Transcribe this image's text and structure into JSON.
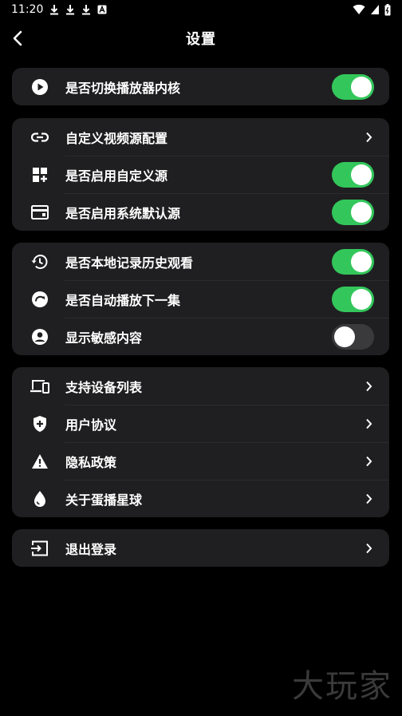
{
  "status": {
    "time": "11:20"
  },
  "header": {
    "title": "设置"
  },
  "groups": [
    {
      "items": [
        {
          "label": "是否切换播放器内核",
          "icon": "play-circle-icon",
          "control": "toggle",
          "on": true
        }
      ]
    },
    {
      "items": [
        {
          "label": "自定义视频源配置",
          "icon": "link-icon",
          "control": "chevron"
        },
        {
          "label": "是否启用自定义源",
          "icon": "grid-add-icon",
          "control": "toggle",
          "on": true
        },
        {
          "label": "是否启用系统默认源",
          "icon": "window-icon",
          "control": "toggle",
          "on": true
        }
      ]
    },
    {
      "items": [
        {
          "label": "是否本地记录历史观看",
          "icon": "history-icon",
          "control": "toggle",
          "on": true
        },
        {
          "label": "是否自动播放下一集",
          "icon": "autoplay-icon",
          "control": "toggle",
          "on": true
        },
        {
          "label": "显示敏感内容",
          "icon": "account-circle-icon",
          "control": "toggle",
          "on": false
        }
      ]
    },
    {
      "items": [
        {
          "label": "支持设备列表",
          "icon": "devices-icon",
          "control": "chevron"
        },
        {
          "label": "用户协议",
          "icon": "shield-icon",
          "control": "chevron"
        },
        {
          "label": "隐私政策",
          "icon": "warning-icon",
          "control": "chevron"
        },
        {
          "label": "关于蛋播星球",
          "icon": "drop-icon",
          "control": "chevron"
        }
      ]
    },
    {
      "items": [
        {
          "label": "退出登录",
          "icon": "logout-icon",
          "control": "chevron"
        }
      ]
    }
  ],
  "watermark": "大玩家"
}
